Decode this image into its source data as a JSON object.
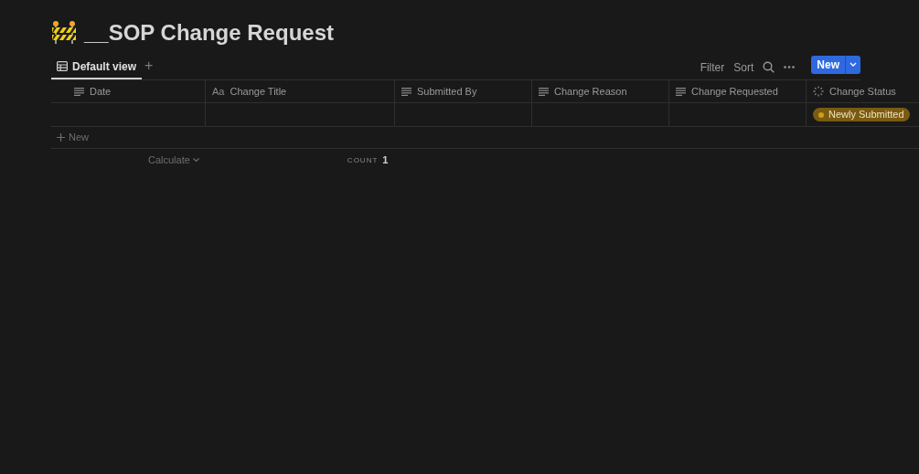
{
  "page": {
    "title": "__SOP Change Request"
  },
  "views": [
    {
      "label": "Default view",
      "selected": true
    }
  ],
  "add_view": "+",
  "toolbar": {
    "filter": "Filter",
    "sort": "Sort",
    "new_button": "New"
  },
  "table": {
    "columns": [
      {
        "label": "Date",
        "kind": "text"
      },
      {
        "label": "Change Title",
        "kind": "title",
        "type_icon": "Aa"
      },
      {
        "label": "Submitted By",
        "kind": "text"
      },
      {
        "label": "Change Reason",
        "kind": "text"
      },
      {
        "label": "Change Requested",
        "kind": "text"
      },
      {
        "label": "Change Status",
        "kind": "status"
      }
    ],
    "rows": [
      {
        "cells": [
          "",
          "",
          "",
          "",
          "",
          {
            "tag": "Newly Submitted",
            "color": "#d29d12"
          }
        ]
      }
    ],
    "new_row": "New",
    "footer": {
      "calculate": "Calculate",
      "count_label": "COUNT",
      "count_value": "1"
    }
  }
}
